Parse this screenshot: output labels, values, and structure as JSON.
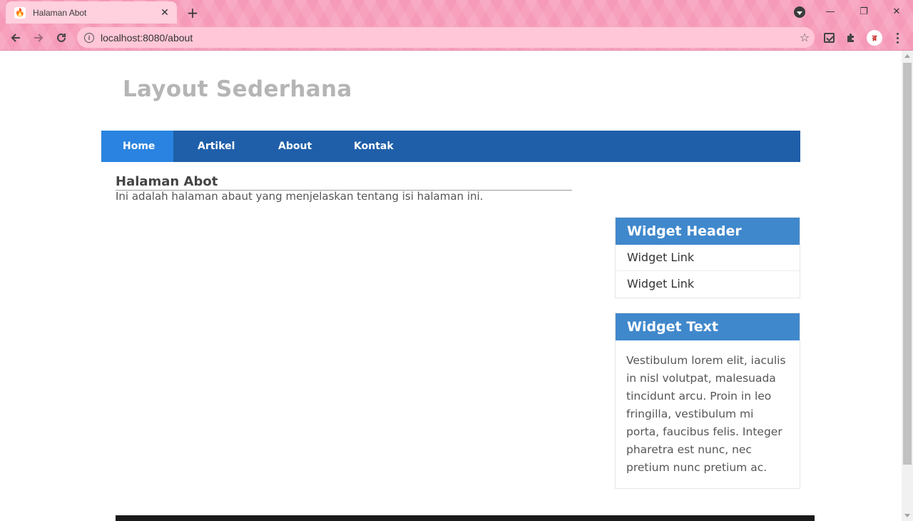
{
  "browser": {
    "tab_title": "Halaman Abot",
    "tab_close": "✕",
    "new_tab": "+",
    "url": "localhost:8080/about",
    "window_controls": {
      "minimize": "—",
      "restore": "❐",
      "close": "✕"
    },
    "avatar_text": "ब्र"
  },
  "site": {
    "title": "Layout Sederhana",
    "nav": [
      {
        "label": "Home",
        "active": true
      },
      {
        "label": "Artikel",
        "active": false
      },
      {
        "label": "About",
        "active": false
      },
      {
        "label": "Kontak",
        "active": false
      }
    ]
  },
  "article": {
    "title": "Halaman Abot",
    "body": "Ini adalah halaman abaut yang menjelaskan tentang isi halaman ini."
  },
  "sidebar": {
    "widget_links": {
      "header": "Widget Header",
      "links": [
        "Widget Link",
        "Widget Link"
      ]
    },
    "widget_text": {
      "header": "Widget Text",
      "text": "Vestibulum lorem elit, iaculis in nisl volutpat, malesuada tincidunt arcu. Proin in leo fringilla, vestibulum mi porta, faucibus felis. Integer pharetra est nunc, nec pretium nunc pretium ac."
    }
  },
  "colors": {
    "nav_bg": "#1f5fa9",
    "nav_active": "#2a83e0",
    "widget_header": "#4088cc",
    "title_gray": "#b5b5b5",
    "chrome_pink": "#f7a1bd"
  }
}
